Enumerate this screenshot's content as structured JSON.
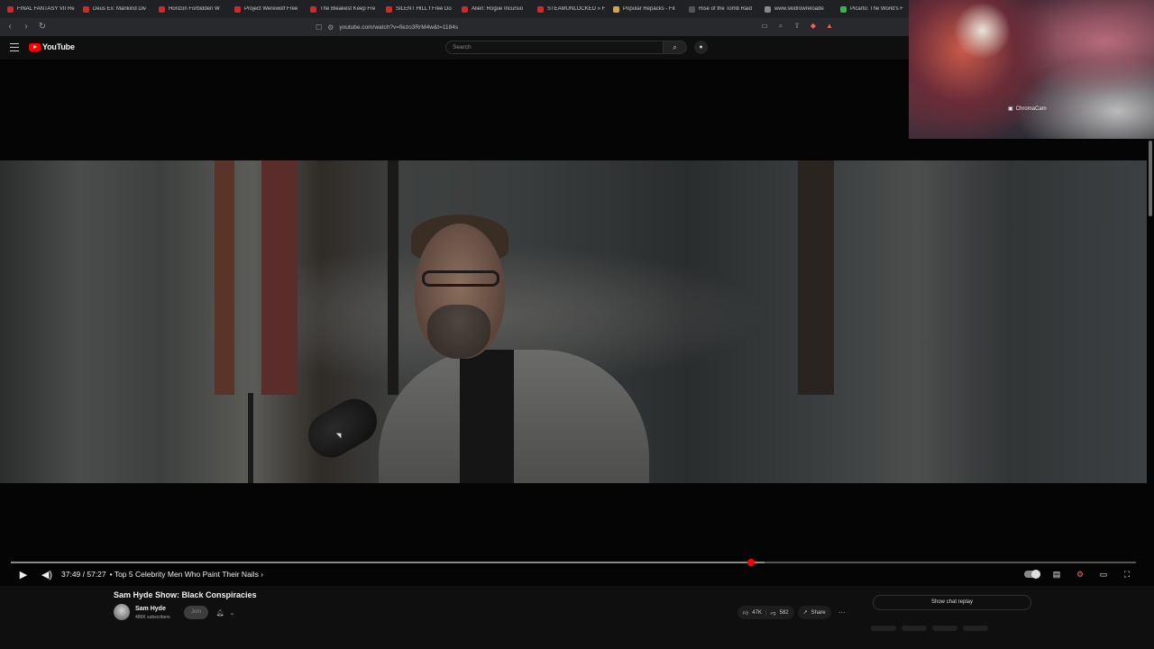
{
  "bookmarks": [
    {
      "label": "FINAL FANTASY VII Re",
      "color": "#c92c2c"
    },
    {
      "label": "Deus Ex: Mankind Div",
      "color": "#c92c2c"
    },
    {
      "label": "Horizon Forbidden W",
      "color": "#c92c2c"
    },
    {
      "label": "Project Werewolf Free",
      "color": "#c92c2c"
    },
    {
      "label": "The Bleakest Keep Fre",
      "color": "#c92c2c"
    },
    {
      "label": "SILENT HILL f Free Do",
      "color": "#c92c2c"
    },
    {
      "label": "Alien: Rogue Incursio",
      "color": "#c92c2c"
    },
    {
      "label": "STEAMUNLOCKED » F",
      "color": "#c92c2c"
    },
    {
      "label": "Popular Repacks - Fit",
      "color": "#d7a24a"
    },
    {
      "label": "Rise of the Tomb Raid",
      "color": "#555555"
    },
    {
      "label": "www.skidrowreloade",
      "color": "#888888"
    },
    {
      "label": "Picarto: The World's F",
      "color": "#3fae5a"
    }
  ],
  "browser": {
    "url": "youtube.com/watch?v=fiezo3RrM4w&t=1184s"
  },
  "youtube": {
    "logo_text": "YouTube",
    "search_placeholder": "Search"
  },
  "player": {
    "current_time": "37:49",
    "duration": "57:27",
    "time_display": "37:49 / 57:27",
    "chapter": "• Top 5 Celebrity Men Who Paint Their Nails ›",
    "progress_fraction": 0.658,
    "buffered_fraction": 0.67
  },
  "video": {
    "title": "Sam Hyde Show: Black Conspiracies",
    "channel_name": "Sam Hyde",
    "subscribers": "486K subscribers",
    "join_label": "Join",
    "likes": "47K",
    "dislikes": "582",
    "share_label": "Share",
    "chat_replay_label": "Show chat replay"
  },
  "webcam": {
    "label": "ChromaCam"
  },
  "colors": {
    "accent": "#ff0000",
    "background": "#0f0f0f"
  }
}
